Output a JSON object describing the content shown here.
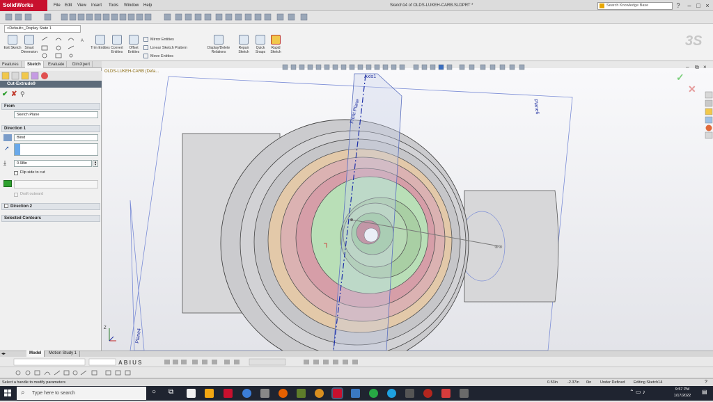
{
  "app": {
    "logo": "SolidWorks",
    "menus": [
      "File",
      "Edit",
      "View",
      "Insert",
      "Tools",
      "Window",
      "Help"
    ],
    "doc_title": "Sketch14 of OLDS-LUKEH-CARB.SLDPRT *",
    "search_placeholder": "Search Knowledge Base",
    "help_icon": "?"
  },
  "config": {
    "value": "<Default>_Display State 1"
  },
  "ribbon": {
    "exit_sketch": "Exit Sketch",
    "smart_dimension": "Smart Dimension",
    "trim_entities": "Trim Entities",
    "convert_entities": "Convert Entities",
    "offset_entities": "Offset Entities",
    "mirror_entities": "Mirror Entities",
    "linear_pattern": "Linear Sketch Pattern",
    "move_entities": "Move Entities",
    "display_delete": "Display/Delete Relations",
    "repair_sketch": "Repair Sketch",
    "quick_snaps": "Quick Snaps",
    "rapid_sketch": "Rapid Sketch"
  },
  "cm_tabs": [
    "Features",
    "Sketch",
    "Evaluate",
    "DimXpert"
  ],
  "property_manager": {
    "feature_title": "Cut-Extrude9",
    "from_header": "From",
    "from_value": "Sketch Plane",
    "dir1_header": "Direction 1",
    "end_condition": "Blind",
    "depth_value": "0.98in",
    "flip_side": "Flip side to cut",
    "draft_outward": "Draft outward",
    "dir2_header": "Direction 2",
    "contours_header": "Selected Contours"
  },
  "viewport": {
    "tree_label": "OLDS-LUKEH-CARB (Defa...",
    "axis_label": "Axis1",
    "front_plane": "Front Plane",
    "plane6": "Plane6",
    "plane4": "Plane4",
    "triad_z": "Z"
  },
  "bottom_tabs": [
    "Model",
    "Motion Study 1"
  ],
  "status": {
    "message": "Select a handle to modify parameters",
    "x": "0.53in",
    "y": "-2.37in",
    "z": "0in",
    "state": "Under Defined",
    "editing": "Editing Sketch14"
  },
  "taskbar": {
    "search": "Type here to search",
    "time": "9:57 PM",
    "date": "1/17/2022"
  }
}
